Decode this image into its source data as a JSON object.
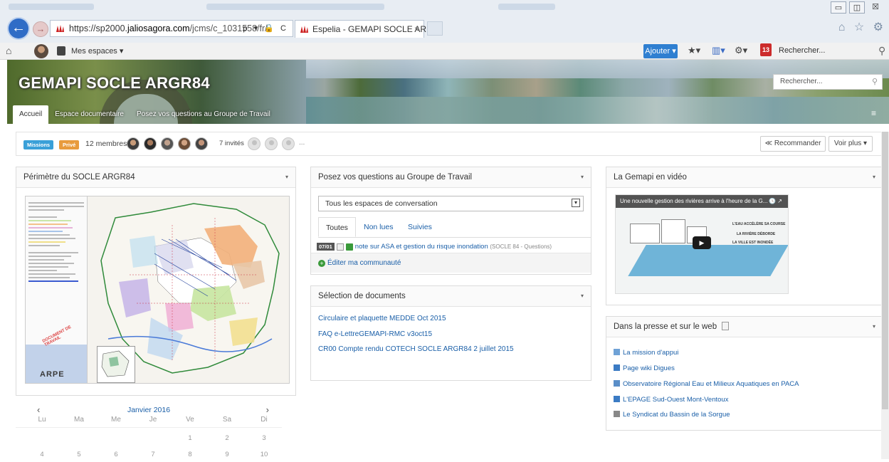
{
  "browser": {
    "url_prefix": "https://sp2000.",
    "url_domain": "jaliosagora.com",
    "url_path": "/jcms/c_1031558/fr/",
    "address_tools": "ρ ▾ 🔒 C",
    "tab_title": "Espelia - GEMAPI SOCLE AR...",
    "tab_close": "×",
    "back_glyph": "←",
    "forward_glyph": "→",
    "chrome_icons": "⌂ ☆ ⚙",
    "window_buttons": [
      "▭",
      "◫",
      "☒"
    ]
  },
  "toolbar": {
    "home_glyph": "⌂",
    "spaces_label": "Mes espaces ▾",
    "add_button": "Ajouter ▾",
    "star_icon": "★▾",
    "view_icon": "▥▾",
    "settings_icon": "⚙▾",
    "notification_count": "13",
    "search_label": "Rechercher...",
    "search_glyph": "⚲"
  },
  "banner": {
    "title": "GEMAPI SOCLE ARGR84",
    "tabs": [
      "Accueil",
      "Espace documentaire",
      "Posez vos questions au Groupe de Travail"
    ],
    "search_placeholder": "Rechercher...",
    "search_glyph": "⚲",
    "menu_glyph": "≡"
  },
  "members": {
    "badge_missions": "Missions",
    "badge_private": "Privé",
    "count_label": "12 membres",
    "guests_label": "7 invités",
    "ellipsis": "...",
    "recommend_button": "≪ Recommander",
    "more_button": "Voir plus ▾"
  },
  "perimetre": {
    "title": "Périmètre du SOCLE ARGR84",
    "caret": "▾",
    "map_logo": "ARPE",
    "map_stamp": "DOCUMENT DE TRAVAIL"
  },
  "calendar": {
    "prev": "‹",
    "next": "›",
    "month": "Janvier 2016",
    "weekdays": [
      "Lu",
      "Ma",
      "Me",
      "Je",
      "Ve",
      "Sa",
      "Di"
    ],
    "weeks": [
      [
        "",
        "",
        "",
        "",
        "1",
        "2",
        "3"
      ],
      [
        "4",
        "5",
        "6",
        "7",
        "8",
        "9",
        "10"
      ]
    ]
  },
  "questions": {
    "title": "Posez vos questions au Groupe de Travail",
    "caret": "▾",
    "select_value": "Tous les espaces de conversation",
    "select_glyph": "▾",
    "tabs": [
      "Toutes",
      "Non lues",
      "Suivies"
    ],
    "item_date": "07/01",
    "item_title": "note sur ASA et gestion du risque inondation",
    "item_source": "(SOCLE 84 - Questions)",
    "edit_link": "Éditer ma communauté",
    "plus_glyph": "+"
  },
  "documents": {
    "title": "Sélection de documents",
    "caret": "▾",
    "links": [
      "Circulaire et plaquette MEDDE Oct 2015",
      "FAQ e-LettreGEMAPI-RMC v3oct15",
      "CR00 Compte rendu COTECH SOCLE ARGR84 2 juillet 2015"
    ]
  },
  "video": {
    "title": "La Gemapi en vidéo",
    "caret": "▾",
    "video_title": "Une nouvelle gestion des rivières arrive à l'heure de la G...",
    "video_controls": "🕓 ↗",
    "play_glyph": "▶",
    "caption_1": "L'EAU ACCÉLÈRE SA COURSE",
    "caption_2": "LA RIVIÈRE DÉBORDE",
    "caption_3": "LA VILLE EST INONDÉE"
  },
  "press": {
    "title": "Dans la presse et sur le web",
    "caret": "▾",
    "links": [
      {
        "label": "La mission d'appui",
        "icon": "#6fa2d6"
      },
      {
        "label": "Page wiki Digues",
        "icon": "#3b7bc4"
      },
      {
        "label": "Observatoire Régional Eau et Milieux Aquatiques en PACA",
        "icon": "#5a8ec8"
      },
      {
        "label": "L'EPAGE Sud-Ouest Mont-Ventoux",
        "icon": "#3b7bc4"
      },
      {
        "label": "Le Syndicat du Bassin de la Sorgue",
        "icon": "#888888"
      }
    ]
  }
}
